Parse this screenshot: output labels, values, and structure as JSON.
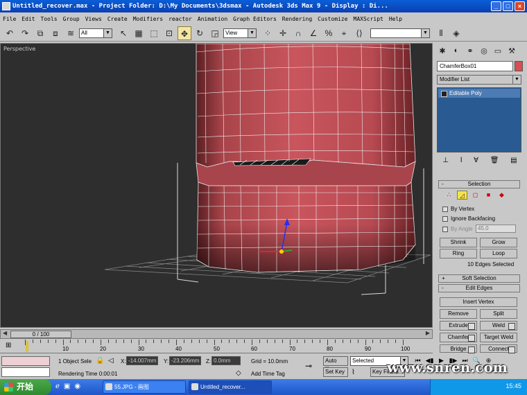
{
  "window": {
    "title": "Untitled_recover.max    - Project Folder: D:\\My Documents\\3dsmax    - Autodesk 3ds Max 9     - Display : Di...",
    "min": "_",
    "max": "□",
    "close": "×"
  },
  "menu": [
    "File",
    "Edit",
    "Tools",
    "Group",
    "Views",
    "Create",
    "Modifiers",
    "reactor",
    "Animation",
    "Graph Editors",
    "Rendering",
    "Customize",
    "MAXScript",
    "Help"
  ],
  "toolbar": {
    "selection_filter": "All",
    "ref_coord": "View"
  },
  "viewport": {
    "label": "Perspective"
  },
  "command_panel": {
    "object_name": "ChamferBox01",
    "modifier_list": "Modifier List",
    "stack_item": "Editable Poly",
    "selection_title": "Selection",
    "by_vertex": "By Vertex",
    "ignore_backfacing": "Ignore Backfacing",
    "by_angle": "By Angle",
    "angle_value": "45.0",
    "shrink": "Shrink",
    "grow": "Grow",
    "ring": "Ring",
    "loop": "Loop",
    "selected_count": "10 Edges Selected",
    "soft_selection": "Soft Selection",
    "edit_edges": "Edit Edges",
    "insert_vertex": "Insert Vertex",
    "remove": "Remove",
    "split": "Split",
    "extrude": "Extrude",
    "weld": "Weld",
    "chamfer": "Chamfer",
    "target_weld": "Target Weld",
    "bridge": "Bridge",
    "connect": "Connect"
  },
  "timeline": {
    "frame": "0 / 100",
    "labels": [
      "0",
      "10",
      "20",
      "30",
      "40",
      "50",
      "60",
      "70",
      "80",
      "90",
      "100"
    ]
  },
  "status": {
    "objects": "1 Object Sele",
    "x_label": "X:",
    "x_val": "-14.007mm",
    "y_label": "Y:",
    "y_val": "-23.206mm",
    "z_label": "Z:",
    "z_val": "0.0mm",
    "grid": "Grid = 10.0mm",
    "rendering_time": "Rendering Time  0:00:01",
    "add_time_tag": "Add Time Tag",
    "auto_key": "Auto Key",
    "selected": "Selected",
    "set_key": "Set Key",
    "key_filters": "Key Filters..."
  },
  "taskbar": {
    "start": "开始",
    "tasks": [
      "55.JPG - 画图",
      "Untitled_recover..."
    ],
    "clock": "15:45"
  },
  "watermark": "www.snren.com"
}
